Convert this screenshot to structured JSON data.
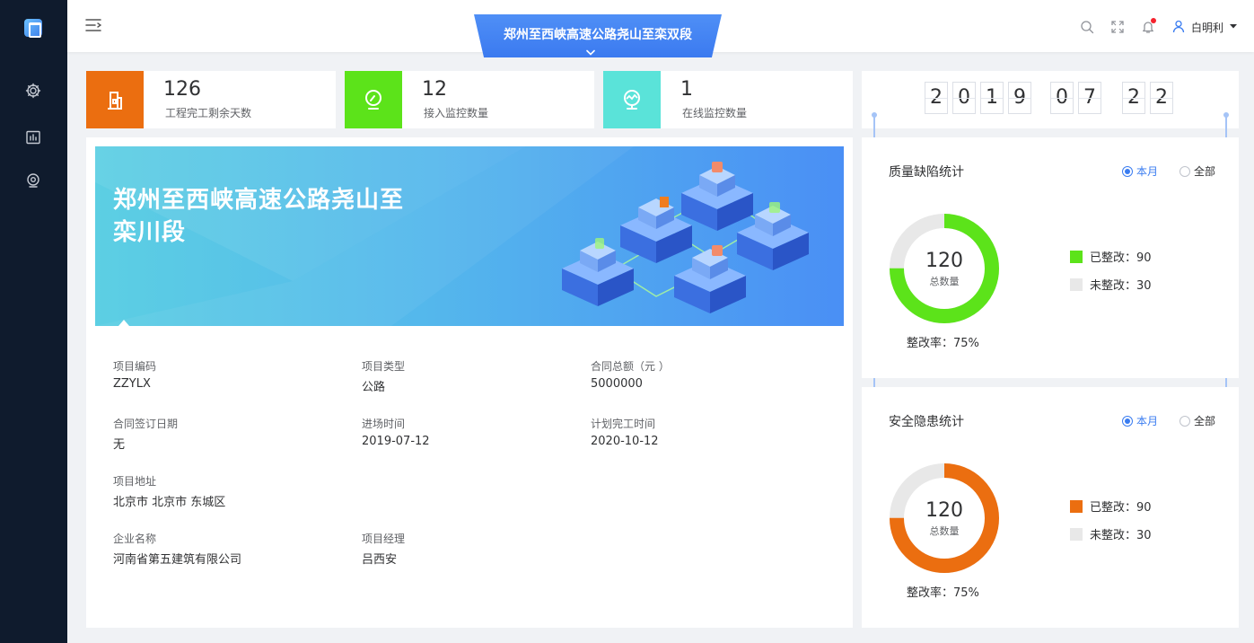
{
  "header": {
    "project_title": "郑州至西峡高速公路尧山至栾双段",
    "user_name": "白明利"
  },
  "colors": {
    "sidebar_bg": "#0f1b2d",
    "accent": "#3a7cf0",
    "stat_orange": "#eb6e10",
    "stat_green": "#5ce31a",
    "stat_cyan": "#5ae3d9",
    "quality_fixed": "#5ce31a",
    "safety_fixed": "#eb6e10",
    "unfixed": "#e8e8e8"
  },
  "sidebar": {
    "items": [
      {
        "icon": "gear-icon"
      },
      {
        "icon": "chart-icon"
      },
      {
        "icon": "monitor-icon"
      }
    ]
  },
  "stats": [
    {
      "value": "126",
      "label": "工程完工剩余天数",
      "icon": "building-icon"
    },
    {
      "value": "12",
      "label": "接入监控数量",
      "icon": "monitor-icon"
    },
    {
      "value": "1",
      "label": "在线监控数量",
      "icon": "monitor-online-icon"
    }
  ],
  "project": {
    "banner_title": "郑州至西峡高速公路尧山至栾川段",
    "fields": {
      "code": {
        "label": "项目编码",
        "value": "ZZYLX"
      },
      "type": {
        "label": "项目类型",
        "value": "公路"
      },
      "amount": {
        "label": "合同总额（元 ）",
        "value": "5000000"
      },
      "sign_date": {
        "label": "合同签订日期",
        "value": "无"
      },
      "entry_time": {
        "label": "进场时间",
        "value": "2019-07-12"
      },
      "plan_finish": {
        "label": "计划完工时间",
        "value": "2020-10-12"
      },
      "address": {
        "label": "项目地址",
        "value": "北京市 北京市 东城区"
      },
      "company": {
        "label": "企业名称",
        "value": "河南省第五建筑有限公司"
      },
      "manager": {
        "label": "项目经理",
        "value": "吕西安"
      }
    }
  },
  "date_digits": [
    "2",
    "0",
    "1",
    "9",
    "0",
    "7",
    "2",
    "2"
  ],
  "quality": {
    "title": "质量缺陷统计",
    "radio_month": "本月",
    "radio_all": "全部",
    "selected": "month",
    "total": "120",
    "total_label": "总数量",
    "fixed_label": "已整改：90",
    "unfixed_label": "未整改：30",
    "rate_label": "整改率：75%",
    "fixed": 90,
    "unfixed": 30
  },
  "safety": {
    "title": "安全隐患统计",
    "radio_month": "本月",
    "radio_all": "全部",
    "selected": "month",
    "total": "120",
    "total_label": "总数量",
    "fixed_label": "已整改：90",
    "unfixed_label": "未整改：30",
    "rate_label": "整改率：75%",
    "fixed": 90,
    "unfixed": 30
  }
}
